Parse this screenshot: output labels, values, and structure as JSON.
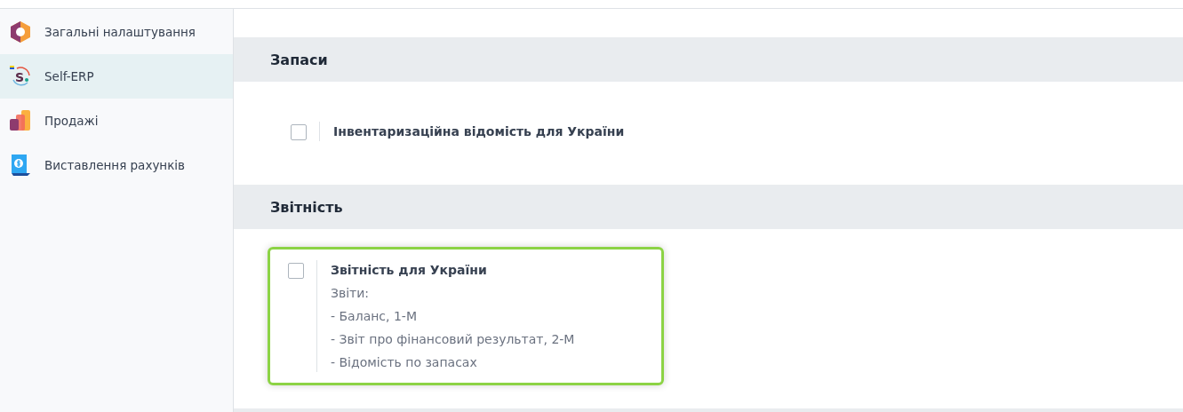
{
  "sidebar": {
    "items": [
      {
        "label": "Загальні налаштування",
        "selected": false
      },
      {
        "label": "Self-ERP",
        "logo_letter": "S",
        "selected": true
      },
      {
        "label": "Продажі",
        "selected": false
      },
      {
        "label": "Виставлення рахунків",
        "selected": false
      }
    ]
  },
  "sections": [
    {
      "title": "Запаси",
      "settings": [
        {
          "label": "Інвентаризаційна відомість для України",
          "checked": false,
          "highlighted": false
        }
      ]
    },
    {
      "title": "Звітність",
      "settings": [
        {
          "label": "Звітність для України",
          "checked": false,
          "highlighted": true,
          "description": [
            "Звіти:",
            "- Баланс, 1-М",
            "- Звіт про фінансовий результат, 2-М",
            "- Відомість по запасах"
          ]
        }
      ]
    }
  ]
}
